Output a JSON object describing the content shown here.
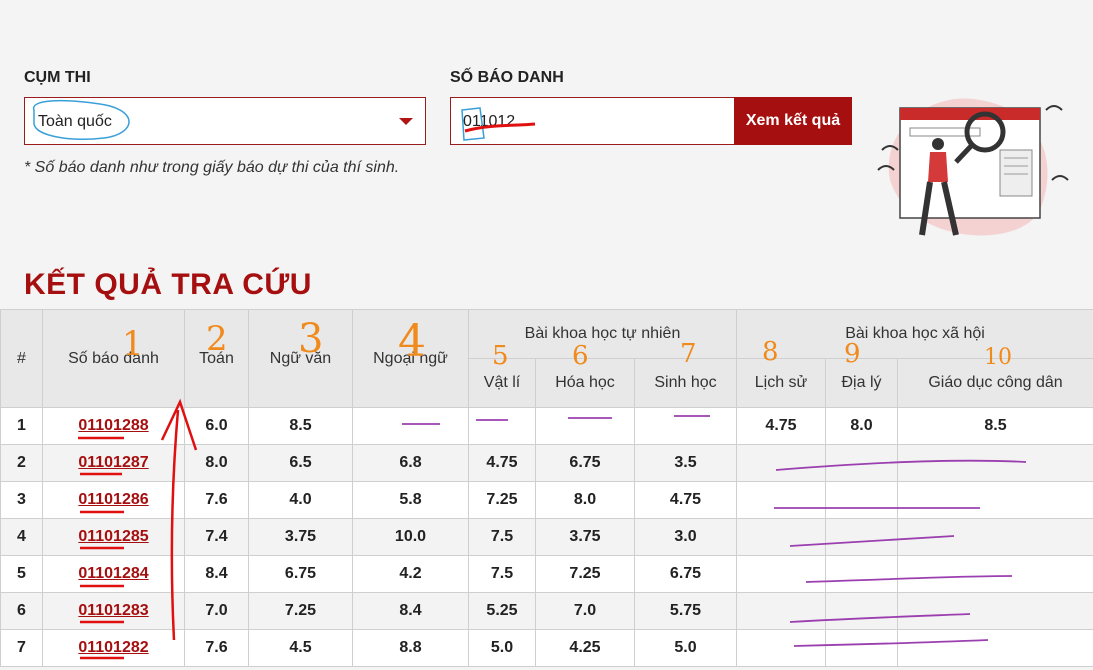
{
  "search": {
    "cluster_label": "CỤM THI",
    "cluster_value": "Toàn quốc",
    "id_label": "SỐ BÁO DANH",
    "id_value": "011012",
    "submit_label": "Xem kết quả",
    "hint": "* Số báo danh như trong giấy báo dự thi của thí sinh."
  },
  "results": {
    "title": "KẾT QUẢ TRA CỨU",
    "headers": {
      "index": "#",
      "id": "Số báo danh",
      "math": "Toán",
      "literature": "Ngữ văn",
      "foreign_language": "Ngoại ngữ",
      "natural_group": "Bài khoa học tự nhiên",
      "physics": "Vật lí",
      "chemistry": "Hóa học",
      "biology": "Sinh học",
      "social_group": "Bài khoa học xã hội",
      "history": "Lịch sử",
      "geography": "Địa lý",
      "civics": "Giáo dục công dân"
    },
    "rows": [
      {
        "no": "1",
        "id": "01101288",
        "math": "6.0",
        "lit": "8.5",
        "lang": "",
        "phy": "",
        "chem": "",
        "bio": "",
        "hist": "4.75",
        "geo": "8.0",
        "civ": "8.5"
      },
      {
        "no": "2",
        "id": "01101287",
        "math": "8.0",
        "lit": "6.5",
        "lang": "6.8",
        "phy": "4.75",
        "chem": "6.75",
        "bio": "3.5",
        "hist": "",
        "geo": "",
        "civ": ""
      },
      {
        "no": "3",
        "id": "01101286",
        "math": "7.6",
        "lit": "4.0",
        "lang": "5.8",
        "phy": "7.25",
        "chem": "8.0",
        "bio": "4.75",
        "hist": "",
        "geo": "",
        "civ": ""
      },
      {
        "no": "4",
        "id": "01101285",
        "math": "7.4",
        "lit": "3.75",
        "lang": "10.0",
        "phy": "7.5",
        "chem": "3.75",
        "bio": "3.0",
        "hist": "",
        "geo": "",
        "civ": ""
      },
      {
        "no": "5",
        "id": "01101284",
        "math": "8.4",
        "lit": "6.75",
        "lang": "4.2",
        "phy": "7.5",
        "chem": "7.25",
        "bio": "6.75",
        "hist": "",
        "geo": "",
        "civ": ""
      },
      {
        "no": "6",
        "id": "01101283",
        "math": "7.0",
        "lit": "7.25",
        "lang": "8.4",
        "phy": "5.25",
        "chem": "7.0",
        "bio": "5.75",
        "hist": "",
        "geo": "",
        "civ": ""
      },
      {
        "no": "7",
        "id": "01101282",
        "math": "7.6",
        "lit": "4.5",
        "lang": "8.8",
        "phy": "5.0",
        "chem": "4.25",
        "bio": "5.0",
        "hist": "",
        "geo": "",
        "civ": ""
      }
    ]
  },
  "annotations": {
    "handwritten_numbers": [
      "1",
      "2",
      "3",
      "4",
      "5",
      "6",
      "7",
      "8",
      "9",
      "10"
    ]
  },
  "colors": {
    "accent": "#a60f0f",
    "background": "#f4f4f4",
    "annotation_orange": "#f08a1c",
    "annotation_red": "#e01010",
    "annotation_purple": "#9b3fb0",
    "annotation_blue": "#3aa0d8"
  }
}
